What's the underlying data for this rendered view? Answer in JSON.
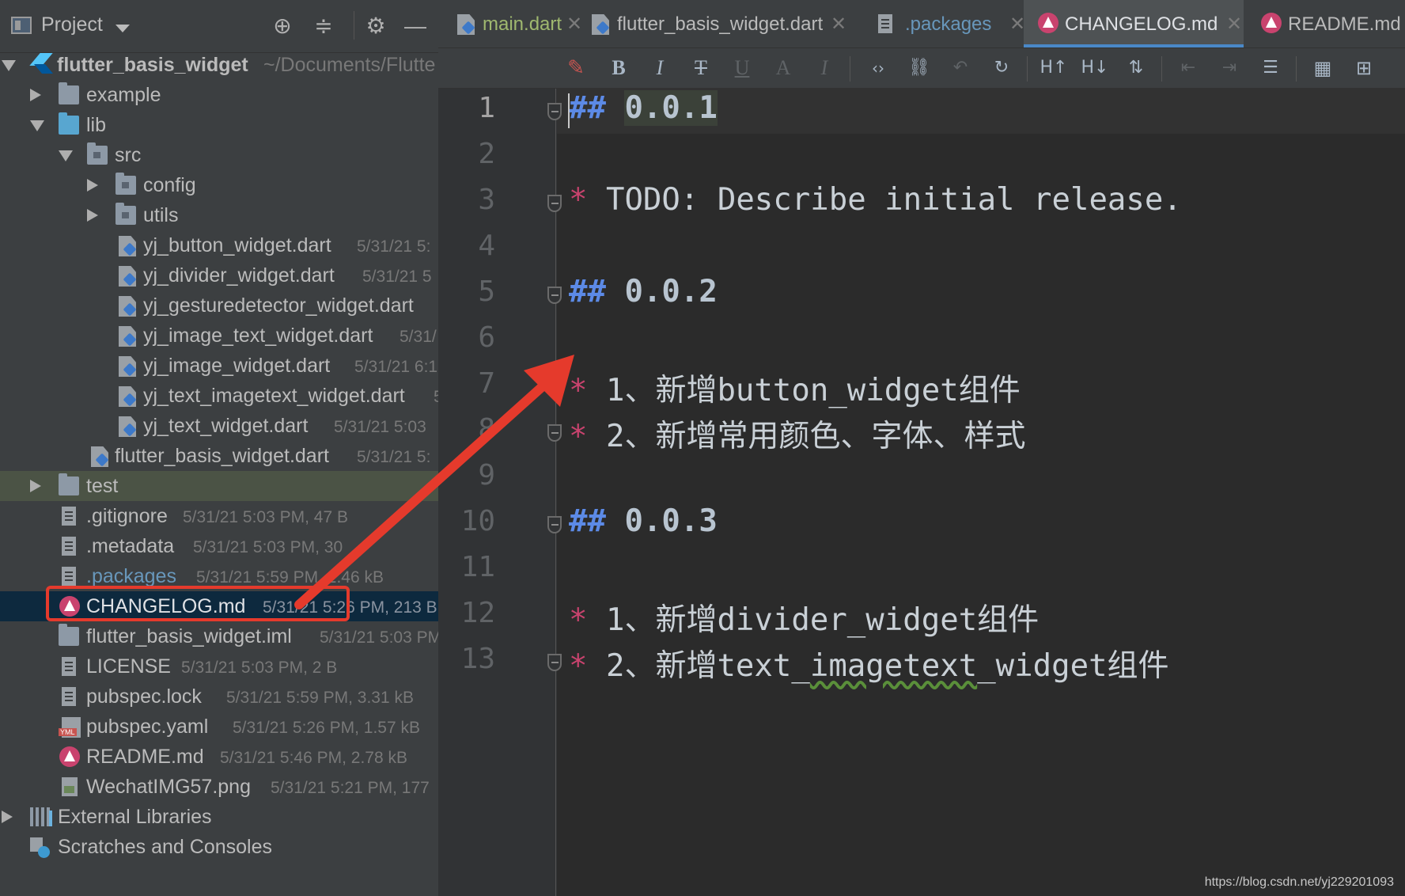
{
  "project_panel": {
    "title": "Project",
    "root": {
      "name": "flutter_basis_widget",
      "path": "~/Documents/Flutte"
    },
    "items": [
      {
        "label": "example",
        "meta": ""
      },
      {
        "label": "lib",
        "meta": ""
      },
      {
        "label": "src",
        "meta": ""
      },
      {
        "label": "config",
        "meta": ""
      },
      {
        "label": "utils",
        "meta": ""
      },
      {
        "label": "yj_button_widget.dart",
        "meta": "5/31/21 5:"
      },
      {
        "label": "yj_divider_widget.dart",
        "meta": "5/31/21 5"
      },
      {
        "label": "yj_gesturedetector_widget.dart",
        "meta": ""
      },
      {
        "label": "yj_image_text_widget.dart",
        "meta": "5/31/"
      },
      {
        "label": "yj_image_widget.dart",
        "meta": "5/31/21 6:1"
      },
      {
        "label": "yj_text_imagetext_widget.dart",
        "meta": "5"
      },
      {
        "label": "yj_text_widget.dart",
        "meta": "5/31/21 5:03"
      },
      {
        "label": "flutter_basis_widget.dart",
        "meta": "5/31/21 5:"
      },
      {
        "label": "test",
        "meta": ""
      },
      {
        "label": ".gitignore",
        "meta": "5/31/21 5:03 PM, 47 B"
      },
      {
        "label": ".metadata",
        "meta": "5/31/21 5:03 PM, 30"
      },
      {
        "label": ".packages",
        "meta": "5/31/21 5:59 PM, 2.46 kB"
      },
      {
        "label": "CHANGELOG.md",
        "meta": "5/31/21 5:26 PM, 213 B"
      },
      {
        "label": "flutter_basis_widget.iml",
        "meta": "5/31/21 5:03 PM"
      },
      {
        "label": "LICENSE",
        "meta": "5/31/21 5:03 PM, 2 B"
      },
      {
        "label": "pubspec.lock",
        "meta": "5/31/21 5:59 PM, 3.31 kB"
      },
      {
        "label": "pubspec.yaml",
        "meta": "5/31/21 5:26 PM, 1.57 kB"
      },
      {
        "label": "README.md",
        "meta": "5/31/21 5:46 PM, 2.78 kB"
      },
      {
        "label": "WechatIMG57.png",
        "meta": "5/31/21 5:21 PM, 177"
      },
      {
        "label": "External Libraries",
        "meta": ""
      },
      {
        "label": "Scratches and Consoles",
        "meta": ""
      }
    ]
  },
  "tabs": [
    {
      "label": "main.dart"
    },
    {
      "label": "flutter_basis_widget.dart"
    },
    {
      "label": ".packages"
    },
    {
      "label": "CHANGELOG.md"
    },
    {
      "label": "README.md"
    }
  ],
  "toolbar": {
    "bold": "B",
    "italic": "I",
    "strike": "T",
    "underline": "U",
    "sup": "A",
    "sub": "I"
  },
  "editor": {
    "line_numbers": [
      "1",
      "2",
      "3",
      "4",
      "5",
      "6",
      "7",
      "8",
      "9",
      "10",
      "11",
      "12",
      "13"
    ],
    "lines": {
      "l1": {
        "hash": "##",
        "text": "0.0.1"
      },
      "l3": {
        "bullet": "*",
        "text": "TODO: Describe initial release."
      },
      "l5": {
        "hash": "##",
        "text": "0.0.2"
      },
      "l7": {
        "bullet": "*",
        "text": "1、新增button_widget组件"
      },
      "l8": {
        "bullet": "*",
        "text": "2、新增常用颜色、字体、样式"
      },
      "l10": {
        "hash": "##",
        "text": "0.0.3"
      },
      "l12": {
        "bullet": "*",
        "text": "1、新增divider_widget组件"
      },
      "l13": {
        "bullet": "*",
        "prefix": "2、新增text_",
        "squiggle": "imagetext",
        "suffix": "_widget组件"
      }
    }
  },
  "watermark": "https://blog.csdn.net/yj229201093",
  "colors": {
    "annotation": "#e53a2c",
    "heading_hash": "#5c8ae6",
    "bullet": "#c9436e",
    "selection": "#0d293e"
  },
  "icons": [
    "window-icon",
    "locate-icon",
    "collapse-all-icon",
    "gear-icon",
    "minimize-icon",
    "folder-icon",
    "dart-file-icon",
    "markdown-icon",
    "text-file-icon",
    "yaml-icon",
    "image-file-icon",
    "libraries-icon",
    "scratches-icon",
    "close-icon"
  ]
}
